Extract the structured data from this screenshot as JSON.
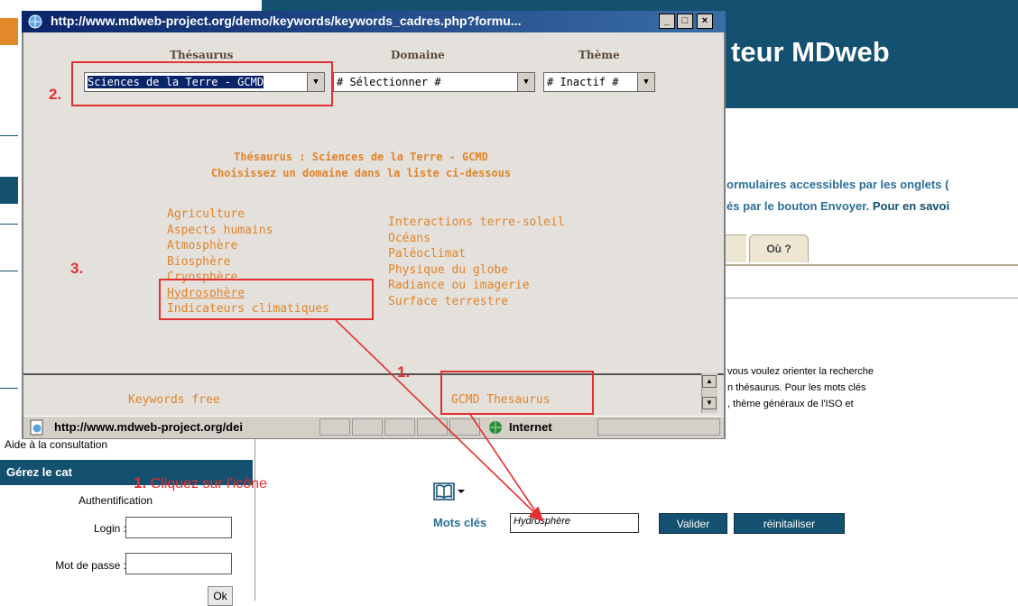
{
  "background": {
    "header_title": "teur MDweb",
    "intro_line1": "ormulaires accessibles par les onglets (",
    "intro_line2a": "és par le bouton Envoyer.",
    "intro_line2b": " Pour en savoi",
    "tab_ou": "Où ?",
    "para_line1": "vous voulez orienter la recherche",
    "para_line2": "n thésaurus. Pour les mots clés",
    "para_line3": ", thème généraux de l'ISO et",
    "sidebar": {
      "help": "Aide à la consultation",
      "section_title": "Gérez le cat",
      "auth": "Authentification",
      "login_label": "Login :",
      "password_label": "Mot de passe :",
      "ok_label": "Ok"
    },
    "form": {
      "keywords_label": "Mots clés",
      "keywords_value": "Hydrosphère",
      "validate_label": "Valider",
      "reset_label": "réinitailiser"
    }
  },
  "popup": {
    "title": "http://www.mdweb-project.org/demo/keywords/keywords_cadres.php?formu...",
    "headers": {
      "thesaurus": "Thésaurus",
      "domain": "Domaine",
      "theme": "Thème"
    },
    "selects": {
      "thesaurus": "Sciences de la Terre - GCMD",
      "domain": "# Sélectionner #",
      "theme": "# Inactif #"
    },
    "info_line1": "Thésaurus : Sciences de la Terre - GCMD",
    "info_line2": "Choisissez un domaine dans la liste ci-dessous",
    "domains_left": [
      "Agriculture",
      "Aspects humains",
      "Atmosphère",
      "Biosphère",
      "Cryosphère",
      "Hydrosphère",
      "Indicateurs climatiques"
    ],
    "domains_right": [
      "Interactions terre-soleil",
      "Océans",
      "Paléoclimat",
      "Physique du globe",
      "Radiance ou imagerie",
      "Surface terrestre"
    ],
    "keywords_free": "Keywords free",
    "gcmd_thesaurus": "GCMD Thesaurus",
    "status_url": "http://www.mdweb-project.org/dei",
    "status_zone": "Internet"
  },
  "annotations": {
    "step2": "2.",
    "step3": "3.",
    "step1": "1.",
    "note_num": "1.",
    "note_text": " Cliquez sur l'icône"
  },
  "colors": {
    "header": "#14506f",
    "link_orange": "#e2842a",
    "annotation_red": "#e23030"
  }
}
